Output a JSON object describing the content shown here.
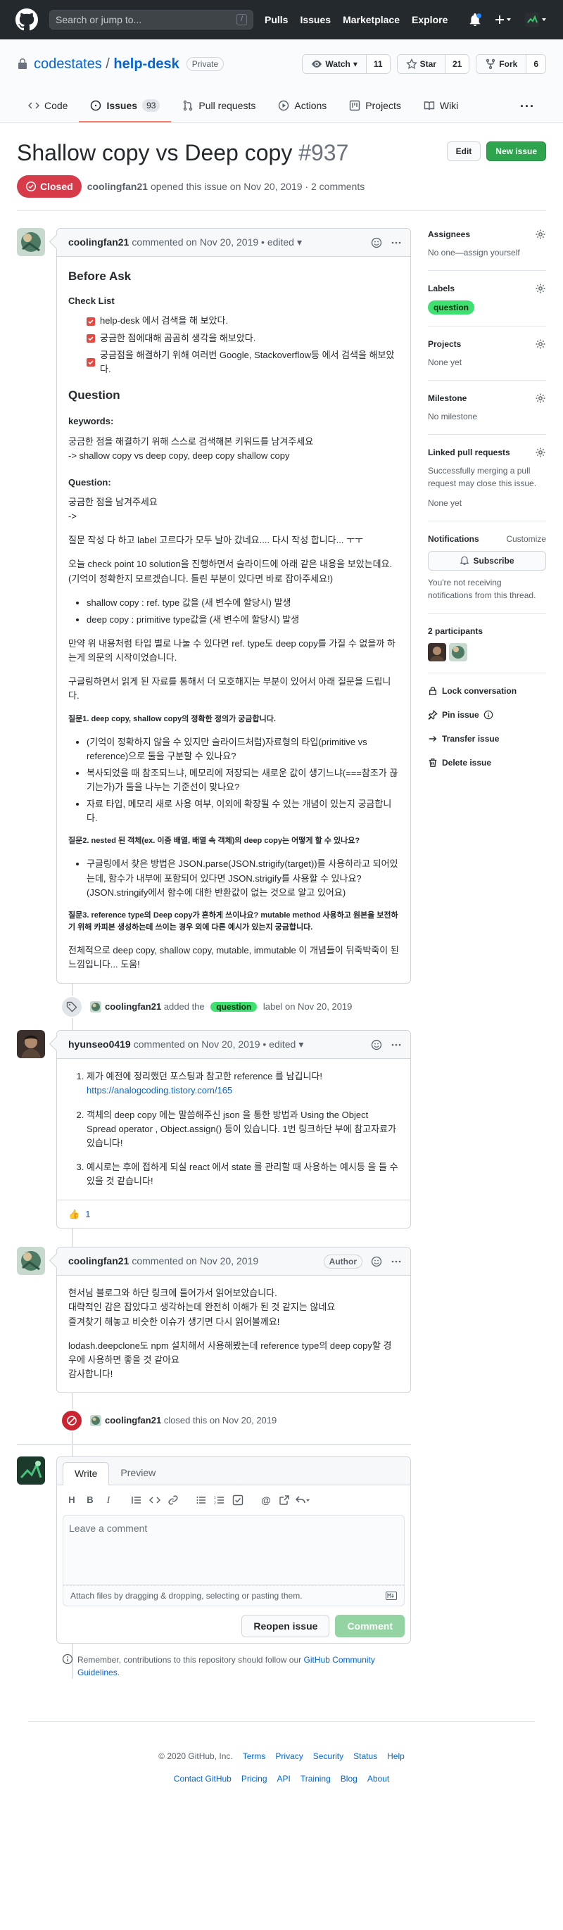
{
  "header": {
    "search_placeholder": "Search or jump to...",
    "search_shortcut": "/",
    "nav": [
      "Pulls",
      "Issues",
      "Marketplace",
      "Explore"
    ]
  },
  "repo": {
    "owner": "codestates",
    "name": "help-desk",
    "visibility": "Private",
    "watch_label": "Watch",
    "watch_count": "11",
    "star_label": "Star",
    "star_count": "21",
    "fork_label": "Fork",
    "fork_count": "6"
  },
  "tabs": [
    {
      "label": "Code"
    },
    {
      "label": "Issues",
      "count": "93"
    },
    {
      "label": "Pull requests"
    },
    {
      "label": "Actions"
    },
    {
      "label": "Projects"
    },
    {
      "label": "Wiki"
    }
  ],
  "tabs_more": "···",
  "issue": {
    "title": "Shallow copy vs Deep copy",
    "number": "#937",
    "edit_label": "Edit",
    "new_issue_label": "New issue",
    "state": "Closed",
    "author": "coolingfan21",
    "meta": "opened this issue on Nov 20, 2019 · 2 comments"
  },
  "comment1": {
    "author": "coolingfan21",
    "meta": "commented on Nov 20, 2019 • edited",
    "h_before": "Before Ask",
    "h_checklist": "Check List",
    "tasks": [
      "help-desk 에서 검색을 해 보았다.",
      "궁금한 점에대해 곰곰히 생각을 해보았다.",
      "궁금점을 해결하기 위해 여러번 Google, Stackoverflow등 에서 검색을 해보았다."
    ],
    "h_question": "Question",
    "h_keywords": "keywords:",
    "keywords_p": "궁금한 점을 해결하기 위해 스스로 검색해본 키워드를 남겨주세요",
    "keywords_p2": "-> shallow copy vs deep copy, deep copy shallow copy",
    "h_question2": "Question:",
    "q_p1": "궁금한 점을 남겨주세요",
    "q_p1b": "->",
    "q_p2": "질문 작성 다 하고 label 고르다가 모두 날아 갔네요.... 다시 작성 합니다... ㅜㅜ",
    "q_p3": "오늘 check point 10 solution을 진행하면서 슬라이드에 아래 같은 내용을 보았는데요. (기억이 정확한지 모르겠습니다. 틀린 부분이 있다면 바로 잡아주세요!)",
    "bullets1": [
      "shallow copy : ref. type 값을 (새 변수에 할당시) 발생",
      "deep copy : primitive type값을 (새 변수에 할당시) 발생"
    ],
    "q_p4": "만약 위 내용처럼 타입 별로 나눌 수 있다면 ref. type도 deep copy를 가질 수 없을까 하는게 의문의 시작이었습니다.",
    "q_p5": "구글링하면서 읽게 된 자료를 통해서 더 모호해지는 부분이 있어서 아래 질문을 드립니다.",
    "q1_title": "질문1. deep copy, shallow copy의 정확한 정의가 궁금합니다.",
    "q1_bullets": [
      "(기억이 정확하지 않을 수 있지만 슬라이드처럼)자료형의 타입(primitive vs reference)으로 둘을 구분할 수 있나요?",
      "복사되었을 때 참조되느냐, 메모리에 저장되는 새로운 값이 생기느냐(===참조가 끊기는가)가 둘을 나누는 기준선이 맞나요?",
      "자료 타입, 메모리 새로 사용 여부, 이외에 확장될 수 있는 개념이 있는지 궁금합니다."
    ],
    "q2_title": "질문2. nested 된 객체(ex. 이중 배열, 배열 속 객체)의 deep copy는 어떻게 할 수 있나요?",
    "q2_bullets": [
      "구글링에서 찾은 방법은 JSON.parse(JSON.strigify(target))를 사용하라고 되어있는데, 함수가 내부에 포함되어 있다면 JSON.strigify를 사용할 수 있나요? (JSON.stringify에서 함수에 대한 반환값이 없는 것으로 알고 있어요)"
    ],
    "q3_title": "질문3. reference type의 Deep copy가 흔하게 쓰이나요? mutable method 사용하고 원본을 보전하기 위해 카피본 생성하는데 쓰이는 경우 외에 다른 예시가 있는지 궁금합니다.",
    "q_end": "전체적으로 deep copy, shallow copy, mutable, immutable 이 개념들이 뒤죽박죽이 된 느낌입니다... 도움!"
  },
  "event_label": {
    "author": "coolingfan21",
    "pre": "added the",
    "label": "question",
    "post": "label on Nov 20, 2019"
  },
  "comment2": {
    "author": "hyunseo0419",
    "meta": "commented on Nov 20, 2019 • edited",
    "item1": "제가 예전에 정리했던 포스팅과 참고한 reference 를 남깁니다!",
    "item1_link": "https://analogcoding.tistory.com/165",
    "item2": "객체의 deep copy 에는 말씀해주신 json 을 통한 방법과 Using the Object Spread operator , Object.assign() 등이 있습니다. 1번 링크하단 부에 참고자료가 있습니다!",
    "item3": "예시로는 후에 접하게 되실 react 에서 state 를 관리할 때 사용하는 예시등 을 들 수 있을 것 같습니다!",
    "reaction": "👍",
    "reaction_count": "1"
  },
  "comment3": {
    "author": "coolingfan21",
    "meta": "commented on Nov 20, 2019",
    "badge": "Author",
    "p1": "현서님 블로그와 하단 링크에 들어가서 읽어보았습니다.",
    "p1b": "대략적인 감은 잡았다고 생각하는데 완전히 이해가 된 것 같지는 않네요",
    "p1c": "즐겨찾기 해놓고 비슷한 이슈가 생기면 다시 읽어볼께요!",
    "p2": "lodash.deepclone도 npm 설치해서 사용해봤는데 reference type의 deep copy할 경우에 사용하면 좋을 것 같아요",
    "p2b": "감사합니다!"
  },
  "event_closed": {
    "author": "coolingfan21",
    "text": "closed this on Nov 20, 2019"
  },
  "composer": {
    "tab_write": "Write",
    "tab_preview": "Preview",
    "placeholder": "Leave a comment",
    "attach": "Attach files by dragging & dropping, selecting or pasting them.",
    "reopen": "Reopen issue",
    "comment": "Comment"
  },
  "tip": {
    "text": "Remember, contributions to this repository should follow our",
    "link": "GitHub Community Guidelines",
    "end": "."
  },
  "sidebar": {
    "assignees_h": "Assignees",
    "assignees_t": "No one—assign yourself",
    "labels_h": "Labels",
    "label": "question",
    "projects_h": "Projects",
    "projects_t": "None yet",
    "milestone_h": "Milestone",
    "milestone_t": "No milestone",
    "linked_h": "Linked pull requests",
    "linked_t": "Successfully merging a pull request may close this issue.",
    "linked_t2": "None yet",
    "notif_h": "Notifications",
    "notif_customize": "Customize",
    "subscribe": "Subscribe",
    "notif_t": "You're not receiving notifications from this thread.",
    "participants_h": "2 participants",
    "lock": "Lock conversation",
    "pin": "Pin issue",
    "transfer": "Transfer issue",
    "delete": "Delete issue"
  },
  "footer": {
    "copyright": "© 2020 GitHub, Inc.",
    "row1": [
      "Terms",
      "Privacy",
      "Security",
      "Status",
      "Help"
    ],
    "row2": [
      "Contact GitHub",
      "Pricing",
      "API",
      "Training",
      "Blog",
      "About"
    ]
  },
  "colors": {
    "closed": "#d73a49",
    "label_question": "#3ee070",
    "primary": "#2ea44f",
    "link": "#0366d6"
  }
}
